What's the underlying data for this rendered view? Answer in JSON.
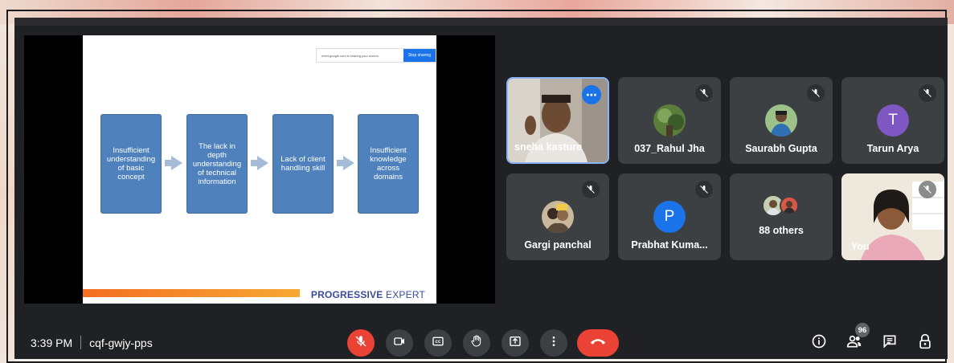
{
  "meeting": {
    "time": "3:39 PM",
    "code": "cqf-gwjy-pps",
    "participant_count_badge": "96"
  },
  "presentation": {
    "share_banner": {
      "text": "meet.google.com is sharing your screen.",
      "stop_label": "Stop sharing"
    },
    "flow_steps": [
      "Insufficient understanding of basic concept",
      "The lack in depth understanding of technical information",
      "Lack of client handling skill",
      "Insufficient knowledge across domains"
    ],
    "footer_bold": "PROGRESSIVE",
    "footer_regular": " EXPERT"
  },
  "participants": [
    {
      "name": "sneha kasture",
      "type": "video",
      "muted": false,
      "active": true
    },
    {
      "name": "037_Rahul Jha",
      "type": "photo",
      "muted": true
    },
    {
      "name": "Saurabh Gupta",
      "type": "photo",
      "muted": true
    },
    {
      "name": "Tarun Arya",
      "type": "initial",
      "initial": "T",
      "color": "#7e57c2",
      "muted": true
    },
    {
      "name": "Gargi panchal",
      "type": "photo",
      "muted": true
    },
    {
      "name": "Prabhat Kuma...",
      "type": "initial",
      "initial": "P",
      "color": "#1a73e8",
      "muted": true
    },
    {
      "name": "88 others",
      "type": "group"
    },
    {
      "name": "You",
      "type": "video",
      "muted": true
    }
  ],
  "controls": {
    "center": [
      "mic-off",
      "camera",
      "captions",
      "raise-hand",
      "present",
      "more-options",
      "end-call"
    ],
    "right": [
      "info",
      "people",
      "chat",
      "host-controls"
    ]
  },
  "colors": {
    "background": "#202124",
    "tile": "#3c4043",
    "danger": "#ea4335",
    "accent": "#1a73e8",
    "slide_box": "#4f81bd"
  }
}
